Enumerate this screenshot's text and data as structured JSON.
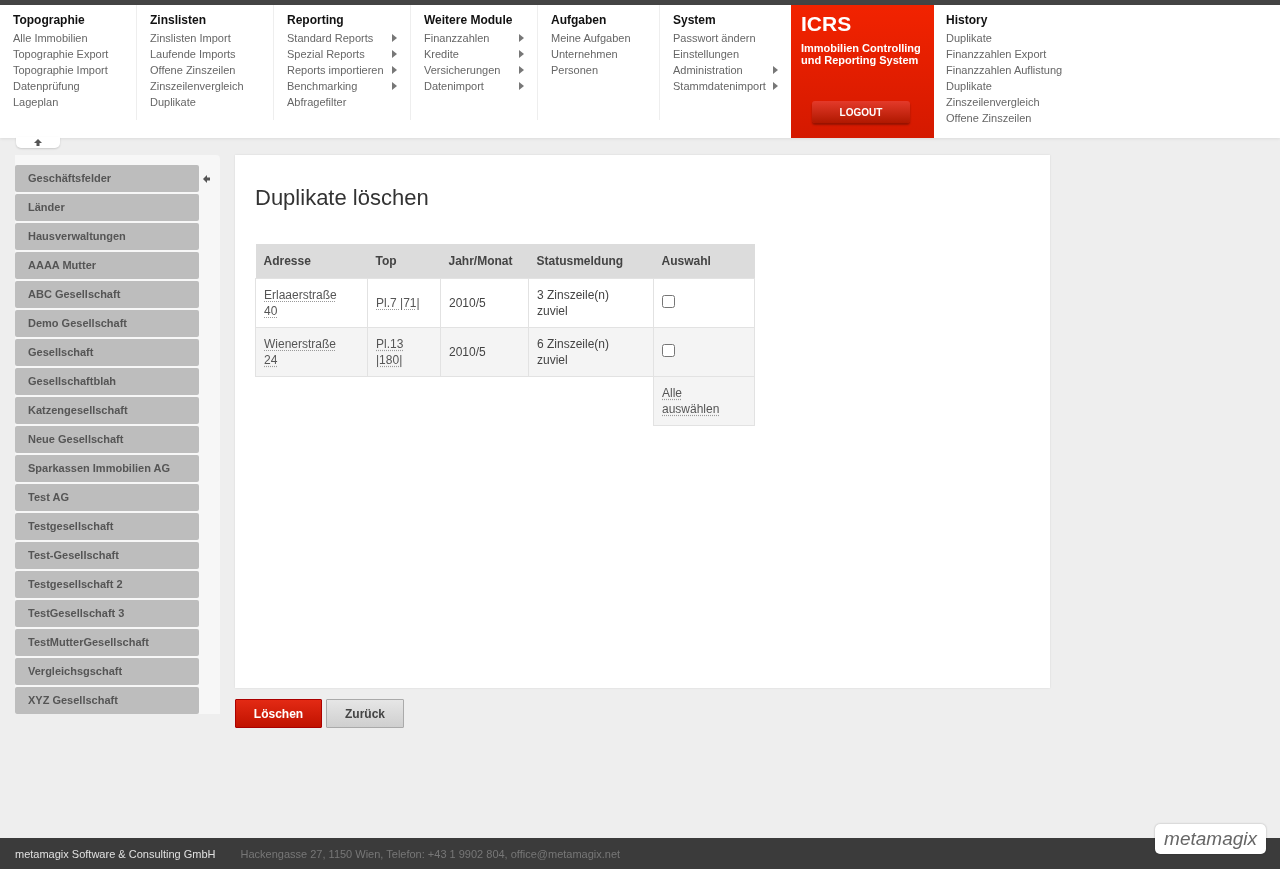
{
  "menu": [
    {
      "title": "Topographie",
      "items": [
        {
          "label": "Alle Immobilien",
          "submenu": false
        },
        {
          "label": "Topographie Export",
          "submenu": false
        },
        {
          "label": "Topographie Import",
          "submenu": false
        },
        {
          "label": "Datenprüfung",
          "submenu": false
        },
        {
          "label": "Lageplan",
          "submenu": false
        }
      ]
    },
    {
      "title": "Zinslisten",
      "items": [
        {
          "label": "Zinslisten Import",
          "submenu": false
        },
        {
          "label": "Laufende Imports",
          "submenu": false
        },
        {
          "label": "Offene Zinszeilen",
          "submenu": false
        },
        {
          "label": "Zinszeilenvergleich",
          "submenu": false
        },
        {
          "label": "Duplikate",
          "submenu": false
        }
      ]
    },
    {
      "title": "Reporting",
      "items": [
        {
          "label": "Standard Reports",
          "submenu": true
        },
        {
          "label": "Spezial Reports",
          "submenu": true
        },
        {
          "label": "Reports importieren",
          "submenu": true
        },
        {
          "label": "Benchmarking",
          "submenu": true
        },
        {
          "label": "Abfragefilter",
          "submenu": false
        }
      ]
    },
    {
      "title": "Weitere Module",
      "items": [
        {
          "label": "Finanzzahlen",
          "submenu": true
        },
        {
          "label": "Kredite",
          "submenu": true
        },
        {
          "label": "Versicherungen",
          "submenu": true
        },
        {
          "label": "Datenimport",
          "submenu": true
        }
      ]
    },
    {
      "title": "Aufgaben",
      "items": [
        {
          "label": "Meine Aufgaben",
          "submenu": false
        },
        {
          "label": "Unternehmen",
          "submenu": false
        },
        {
          "label": "Personen",
          "submenu": false
        }
      ]
    },
    {
      "title": "System",
      "items": [
        {
          "label": "Passwort ändern",
          "submenu": false
        },
        {
          "label": "Einstellungen",
          "submenu": false
        },
        {
          "label": "Administration",
          "submenu": true
        },
        {
          "label": "Stammdatenimport",
          "submenu": true
        }
      ]
    }
  ],
  "brand": {
    "title": "ICRS",
    "subtitle": "Immobilien Controlling und Reporting System",
    "logout": "LOGOUT"
  },
  "history": {
    "title": "History",
    "items": [
      "Duplikate",
      "Finanzzahlen Export",
      "Finanzzahlen Auflistung",
      "Duplikate",
      "Zinszeilenvergleich",
      "Offene Zinszeilen"
    ]
  },
  "sidebar": {
    "items": [
      "Geschäftsfelder",
      "Länder",
      "Hausverwaltungen",
      "AAAA Mutter",
      "ABC Gesellschaft",
      "Demo Gesellschaft",
      "Gesellschaft",
      "Gesellschaftblah",
      "Katzengesellschaft",
      "Neue Gesellschaft",
      "Sparkassen Immobilien AG",
      "Test AG",
      "Testgesellschaft",
      "Test-Gesellschaft",
      "Testgesellschaft 2",
      "TestGesellschaft 3",
      "TestMutterGesellschaft",
      "Vergleichsgschaft",
      "XYZ Gesellschaft"
    ]
  },
  "page": {
    "title": "Duplikate löschen"
  },
  "table": {
    "columns": [
      "Adresse",
      "Top",
      "Jahr/Monat",
      "Statusmeldung",
      "Auswahl"
    ],
    "rows": [
      {
        "address": "Erlaaerstraße 40",
        "top": "Pl.7 |71|",
        "period": "2010/5",
        "status": "3 Zinszeile(n) zuviel",
        "checked": false
      },
      {
        "address": "Wienerstraße 24",
        "top": "Pl.13 |180|",
        "period": "2010/5",
        "status": "6 Zinszeile(n) zuviel",
        "checked": false
      }
    ],
    "select_all": "Alle auswählen"
  },
  "buttons": {
    "delete": "Löschen",
    "back": "Zurück"
  },
  "footer": {
    "company": "metamagix Software & Consulting GmbH",
    "address": "Hackengasse 27, 1150 Wien, Telefon: +43 1 9902 804, office@metamagix.net",
    "logo": "metamagix"
  }
}
